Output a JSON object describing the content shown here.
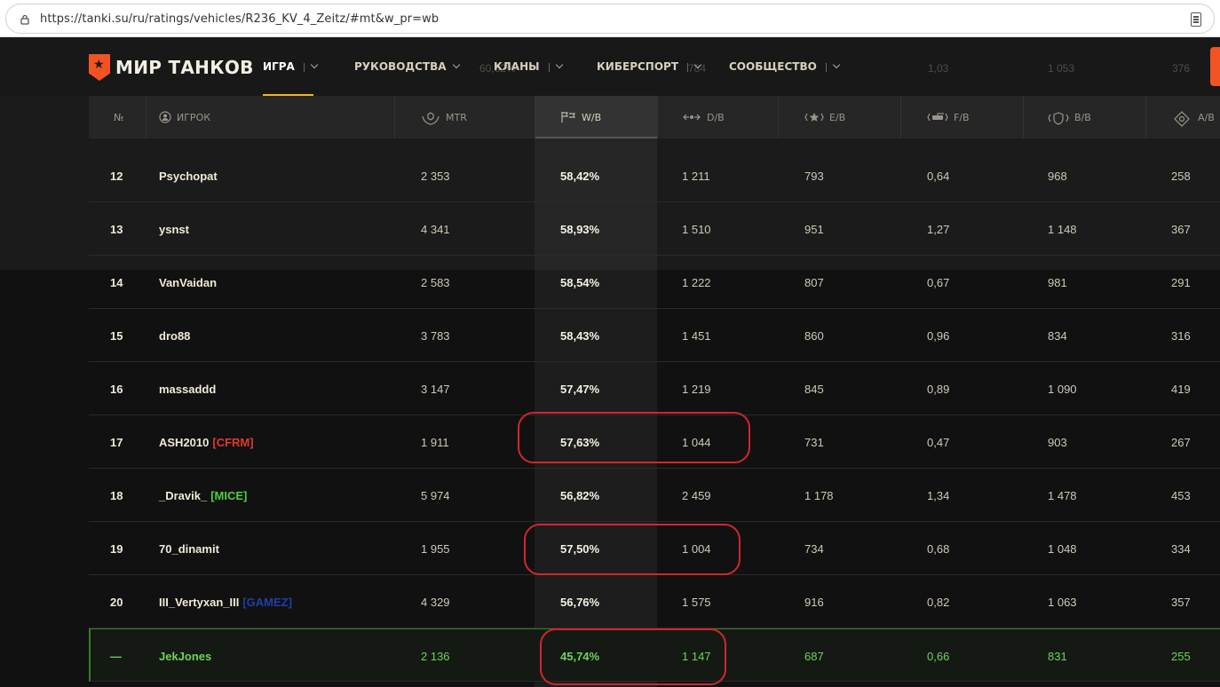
{
  "browser": {
    "url": "https://tanki.su/ru/ratings/vehicles/R236_KV_4_Zeitz/#mt&w_pr=wb"
  },
  "header": {
    "logo_text": "МИР ТАНКОВ",
    "nav": [
      {
        "label": "ИГРА"
      },
      {
        "label": "РУКОВОДСТВА"
      },
      {
        "label": "КЛАНЫ"
      },
      {
        "label": "КИБЕРСПОРТ"
      },
      {
        "label": "СООБЩЕСТВО"
      }
    ],
    "ghost_row": [
      "60,32%",
      "784",
      "1,03",
      "1 053",
      "376"
    ]
  },
  "table": {
    "columns": [
      {
        "key": "rank",
        "label": "№",
        "icon": "number-icon"
      },
      {
        "key": "player",
        "label": "ИГРОК",
        "icon": "player-icon"
      },
      {
        "key": "mtr",
        "label": "MTR",
        "icon": "mtr-icon"
      },
      {
        "key": "wb",
        "label": "W/B",
        "icon": "flags-icon"
      },
      {
        "key": "db",
        "label": "D/B",
        "icon": "damage-icon"
      },
      {
        "key": "eb",
        "label": "E/B",
        "icon": "experience-icon"
      },
      {
        "key": "fb",
        "label": "F/B",
        "icon": "frags-icon"
      },
      {
        "key": "bb",
        "label": "B/B",
        "icon": "blocked-icon"
      },
      {
        "key": "ab",
        "label": "A/B",
        "icon": "assist-icon"
      }
    ],
    "rows": [
      {
        "rank": "12",
        "player": "Psychopat",
        "clan": "",
        "mtr": "2 353",
        "wb": "58,42%",
        "db": "1 211",
        "eb": "793",
        "fb": "0,64",
        "bb": "968",
        "ab": "258"
      },
      {
        "rank": "13",
        "player": "ysnst",
        "clan": "",
        "mtr": "4 341",
        "wb": "58,93%",
        "db": "1 510",
        "eb": "951",
        "fb": "1,27",
        "bb": "1 148",
        "ab": "367"
      },
      {
        "rank": "14",
        "player": "VanVaidan",
        "clan": "",
        "mtr": "2 583",
        "wb": "58,54%",
        "db": "1 222",
        "eb": "807",
        "fb": "0,67",
        "bb": "981",
        "ab": "291"
      },
      {
        "rank": "15",
        "player": "dro88",
        "clan": "",
        "mtr": "3 783",
        "wb": "58,43%",
        "db": "1 451",
        "eb": "860",
        "fb": "0,96",
        "bb": "834",
        "ab": "316"
      },
      {
        "rank": "16",
        "player": "massaddd",
        "clan": "",
        "mtr": "3 147",
        "wb": "57,47%",
        "db": "1 219",
        "eb": "845",
        "fb": "0,89",
        "bb": "1 090",
        "ab": "419"
      },
      {
        "rank": "17",
        "player": "ASH2010",
        "clan": "[CFRM]",
        "clan_color": "#e03a2e",
        "mtr": "1 911",
        "wb": "57,63%",
        "db": "1 044",
        "eb": "731",
        "fb": "0,47",
        "bb": "903",
        "ab": "267"
      },
      {
        "rank": "18",
        "player": "_Dravik_",
        "clan": "[MICE]",
        "clan_color": "#4fcf3f",
        "mtr": "5 974",
        "wb": "56,82%",
        "db": "2 459",
        "eb": "1 178",
        "fb": "1,34",
        "bb": "1 478",
        "ab": "453"
      },
      {
        "rank": "19",
        "player": "70_dinamit",
        "clan": "",
        "mtr": "1 955",
        "wb": "57,50%",
        "db": "1 004",
        "eb": "734",
        "fb": "0,68",
        "bb": "1 048",
        "ab": "334"
      },
      {
        "rank": "20",
        "player": "III_Vertyxan_III",
        "clan": "[GAMEZ]",
        "clan_color": "#1f3fa8",
        "mtr": "4 329",
        "wb": "56,76%",
        "db": "1 575",
        "eb": "916",
        "fb": "0,82",
        "bb": "1 063",
        "ab": "357"
      },
      {
        "rank": "—",
        "player": "JekJones",
        "clan": "",
        "mtr": "2 136",
        "wb": "45,74%",
        "db": "1 147",
        "eb": "687",
        "fb": "0,66",
        "bb": "831",
        "ab": "255",
        "is_me": true
      }
    ]
  },
  "colors": {
    "accent": "#f25322",
    "highlight_green": "#6fd15a",
    "annotation_red": "#d3262b"
  }
}
